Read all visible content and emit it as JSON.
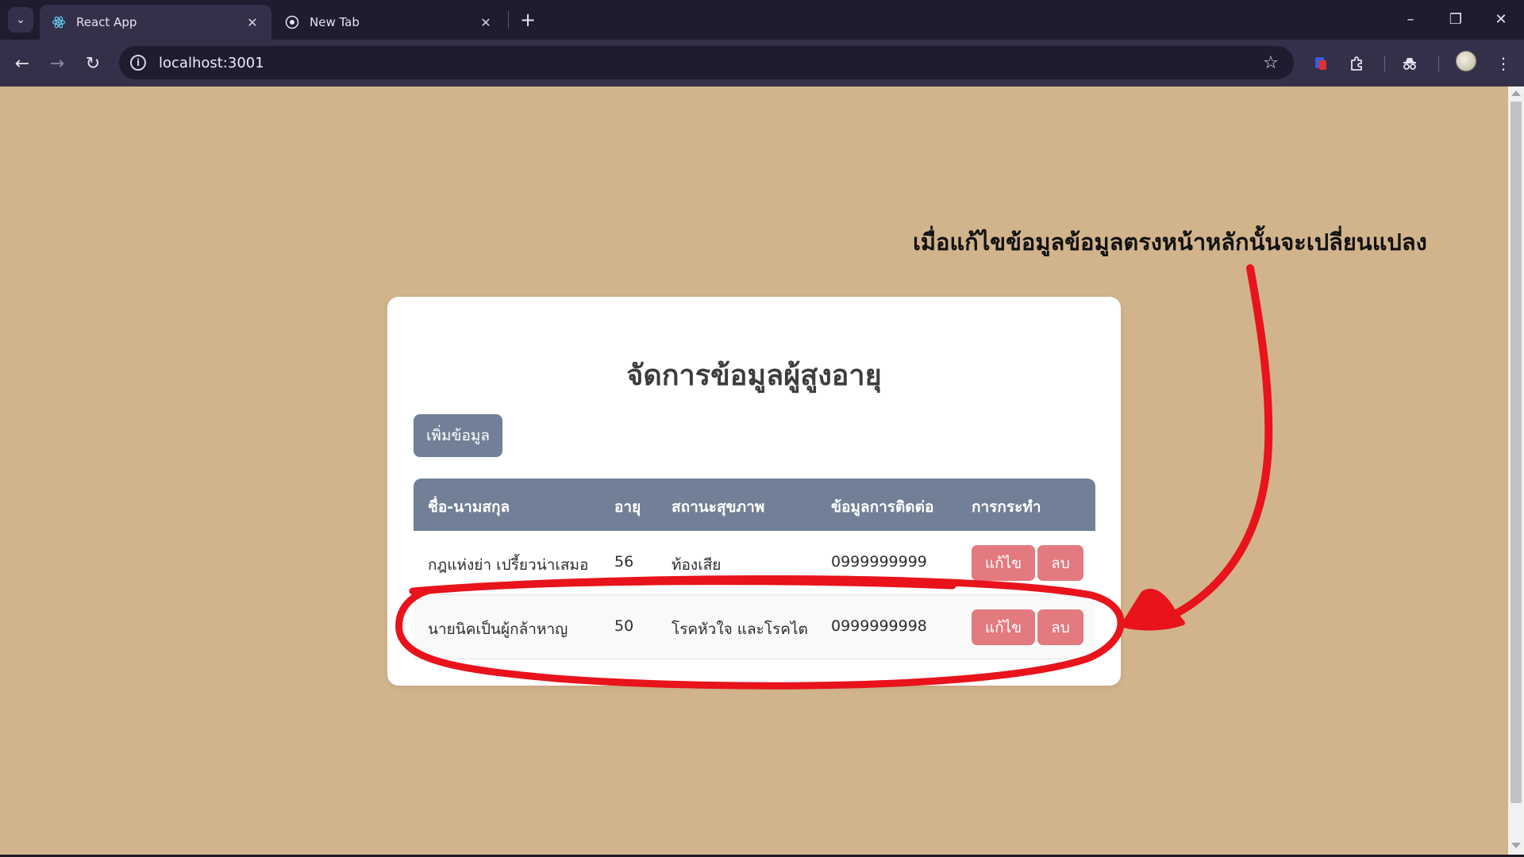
{
  "browser": {
    "tabs": [
      {
        "title": "React App",
        "active": true
      },
      {
        "title": "New Tab",
        "active": false
      }
    ],
    "url": "localhost:3001"
  },
  "page": {
    "title": "จัดการข้อมูลผู้สูงอายุ",
    "add_button": "เพิ่มข้อมูล",
    "table": {
      "headers": [
        "ชื่อ-นามสกุล",
        "อายุ",
        "สถานะสุขภาพ",
        "ข้อมูลการติดต่อ",
        "การกระทำ"
      ],
      "rows": [
        {
          "name": "กฎแห่งย่า เปรี้ยวน่าเสมอ",
          "age": "56",
          "health": "ท้องเสีย",
          "contact": "0999999999"
        },
        {
          "name": "นายนิคเป็นผู้กล้าหาญ",
          "age": "50",
          "health": "โรคหัวใจ และโรคไต",
          "contact": "0999999998"
        }
      ],
      "edit_label": "แก้ไข",
      "delete_label": "ลบ"
    }
  },
  "annotation": {
    "text": "เมื่อแก้ไขข้อมูลข้อมูลตรงหน้าหลักนั้นจะเปลี่ยนแปลง",
    "color": "#e8131b"
  },
  "colors": {
    "page_bg": "#d2b48c",
    "header_bg": "#718096",
    "action_btn": "#e27a7f"
  },
  "icons": [
    "tab-search-icon",
    "react-icon",
    "chrome-icon",
    "back-icon",
    "forward-icon",
    "reload-icon",
    "site-info-icon",
    "star-icon",
    "extensions-icon",
    "incognito-icon",
    "menu-icon"
  ]
}
